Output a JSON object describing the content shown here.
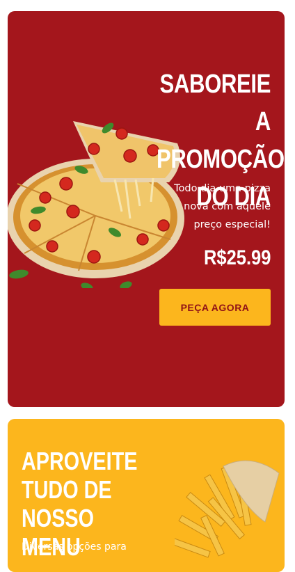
{
  "promo": {
    "headline_lines": [
      "SABOREIE A",
      "PROMOÇÃO",
      "DO DIA"
    ],
    "description_lines": [
      "Todo dia uma pizza",
      "nova com aquele",
      "preço especial!"
    ],
    "price": "R$25.99",
    "cta_label": "PEÇA AGORA",
    "image": "pizza-image",
    "colors": {
      "background": "#a4161c",
      "cta": "#fcb61d",
      "cta_text": "#8f1117"
    }
  },
  "menu": {
    "headline_lines": [
      "APROVEITE",
      "TUDO DE",
      "NOSSO MENU"
    ],
    "description": "Diversas opções para",
    "image": "fries-image",
    "colors": {
      "background": "#fcb61d"
    }
  }
}
